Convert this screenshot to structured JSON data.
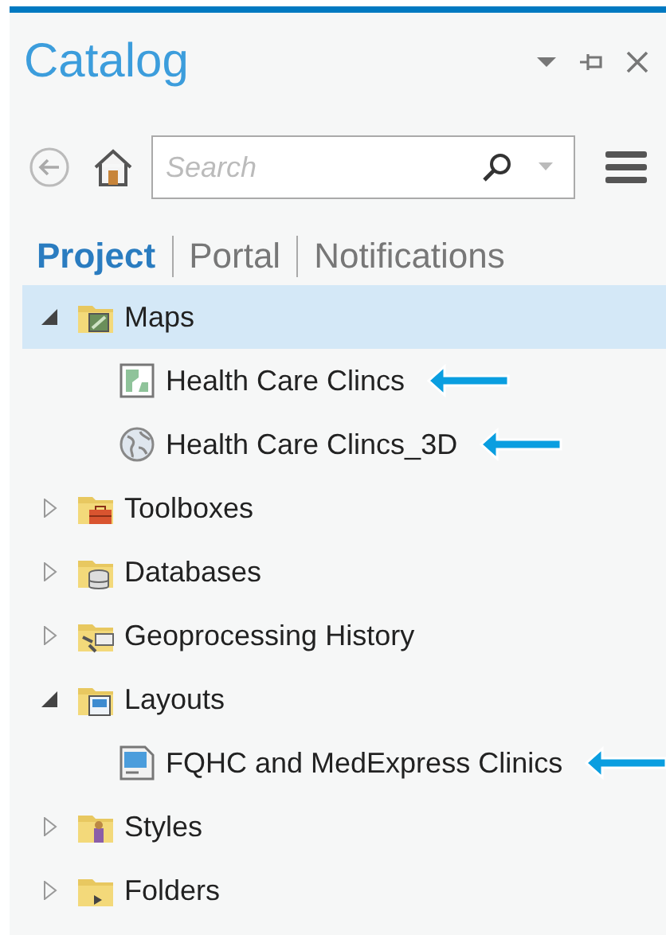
{
  "pane": {
    "title": "Catalog"
  },
  "search": {
    "placeholder": "Search"
  },
  "tabs": [
    {
      "label": "Project",
      "selected": true
    },
    {
      "label": "Portal",
      "selected": false
    },
    {
      "label": "Notifications",
      "selected": false
    }
  ],
  "tree": [
    {
      "label": "Maps",
      "kind": "maps-folder",
      "expanded": true,
      "selected": true,
      "children": [
        {
          "label": "Health Care Clincs",
          "kind": "map",
          "selected": false,
          "pointer_arrow": true
        },
        {
          "label": "Health Care Clincs_3D",
          "kind": "scene",
          "selected": false,
          "pointer_arrow": true
        }
      ]
    },
    {
      "label": "Toolboxes",
      "kind": "toolbox-folder",
      "expanded": false,
      "selected": false
    },
    {
      "label": "Databases",
      "kind": "database-folder",
      "expanded": false,
      "selected": false
    },
    {
      "label": "Geoprocessing History",
      "kind": "history-folder",
      "expanded": false,
      "selected": false
    },
    {
      "label": "Layouts",
      "kind": "layout-folder",
      "expanded": true,
      "selected": false,
      "children": [
        {
          "label": "FQHC and MedExpress Clinics",
          "kind": "layout",
          "selected": false,
          "pointer_arrow": true
        }
      ]
    },
    {
      "label": "Styles",
      "kind": "style-folder",
      "expanded": false,
      "selected": false
    },
    {
      "label": "Folders",
      "kind": "folder",
      "expanded": false,
      "selected": false
    }
  ]
}
